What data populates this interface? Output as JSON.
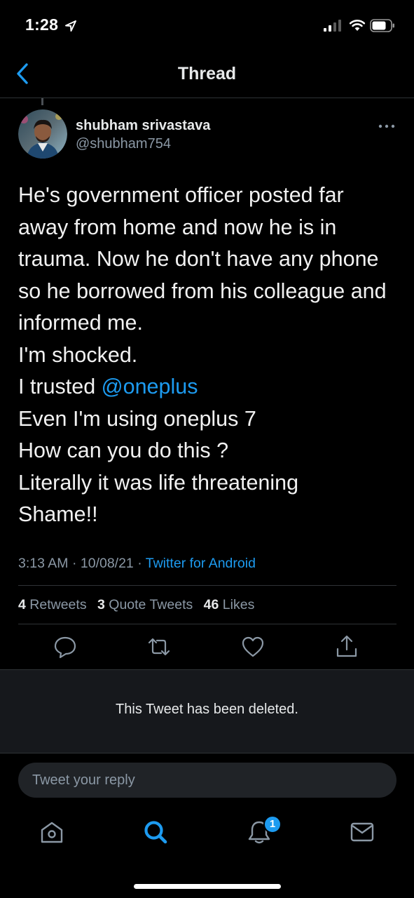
{
  "status_bar": {
    "time": "1:28",
    "icons": [
      "location-arrow-icon",
      "cellular-signal-icon",
      "wifi-icon",
      "battery-icon"
    ]
  },
  "nav": {
    "title": "Thread",
    "back_icon": "chevron-left-icon"
  },
  "tweet": {
    "author_name": "shubham srivastava",
    "author_handle": "@shubham754",
    "lines": [
      "He's government officer posted far",
      "away from home and now he is in",
      "trauma. Now he don't have any phone",
      "so he borrowed from his colleague and",
      "informed me.",
      "I'm shocked."
    ],
    "mention_prefix": "I trusted ",
    "mention": "@oneplus",
    "lines_after": [
      "Even I'm using oneplus 7",
      "How can you do this ?",
      "Literally it was life threatening",
      "Shame!!"
    ],
    "timestamp": "3:13 AM · 10/08/21 · ",
    "source": "Twitter for Android",
    "stats": {
      "retweets_count": "4",
      "retweets_label": "Retweets",
      "quotes_count": "3",
      "quotes_label": "Quote Tweets",
      "likes_count": "46",
      "likes_label": "Likes"
    },
    "actions": [
      "reply-icon",
      "retweet-icon",
      "like-icon",
      "share-icon"
    ]
  },
  "deleted_notice": "This Tweet has been deleted.",
  "reply_box": {
    "placeholder": "Tweet your reply"
  },
  "tab_bar": {
    "items": [
      "home-icon",
      "search-icon",
      "notifications-icon",
      "messages-icon"
    ],
    "notification_badge": "1",
    "active_color": "#1d9bf0"
  },
  "colors": {
    "background": "#000000",
    "accent": "#1d9bf0",
    "secondary_text": "#8b98a5",
    "divider": "#2f3336"
  }
}
